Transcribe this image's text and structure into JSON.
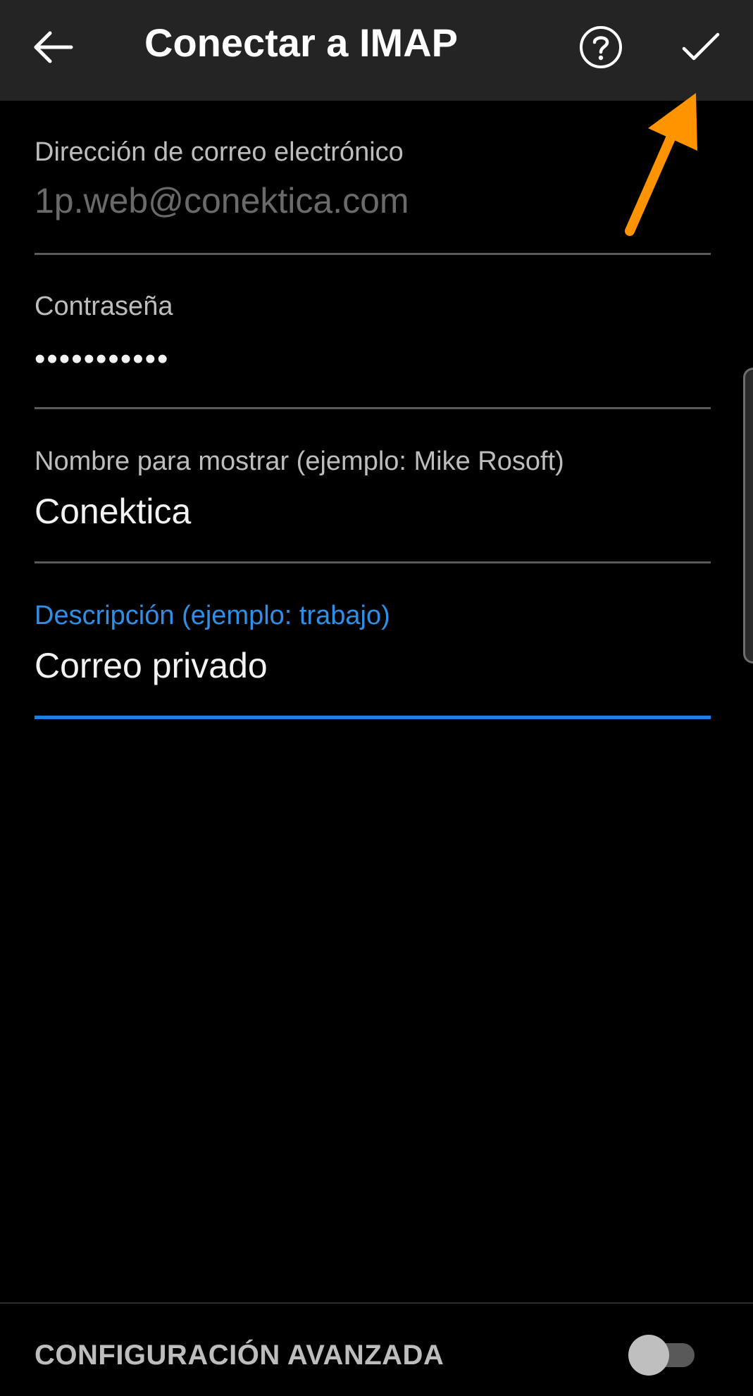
{
  "toolbar": {
    "back_icon": "arrow-left-icon",
    "title": "Conectar a IMAP",
    "help_icon": "help-circle-icon",
    "done_icon": "checkmark-icon"
  },
  "form": {
    "email": {
      "label": "Dirección de correo electrónico",
      "value": "1p.web@conektica.com"
    },
    "password": {
      "label": "Contraseña",
      "value": "•••••••••••"
    },
    "display_name": {
      "label": "Nombre para mostrar (ejemplo: Mike Rosoft)",
      "value": "Conektica"
    },
    "description": {
      "label": "Descripción (ejemplo: trabajo)",
      "value": "Correo privado"
    }
  },
  "advanced": {
    "label": "CONFIGURACIÓN AVANZADA",
    "enabled": false
  },
  "annotation": {
    "icon": "orange-arrow-annotation",
    "color": "#ff9400"
  },
  "colors": {
    "toolbar_bg": "#242424",
    "background": "#000000",
    "accent": "#1f7ee0",
    "divider": "#5a5a5a"
  }
}
